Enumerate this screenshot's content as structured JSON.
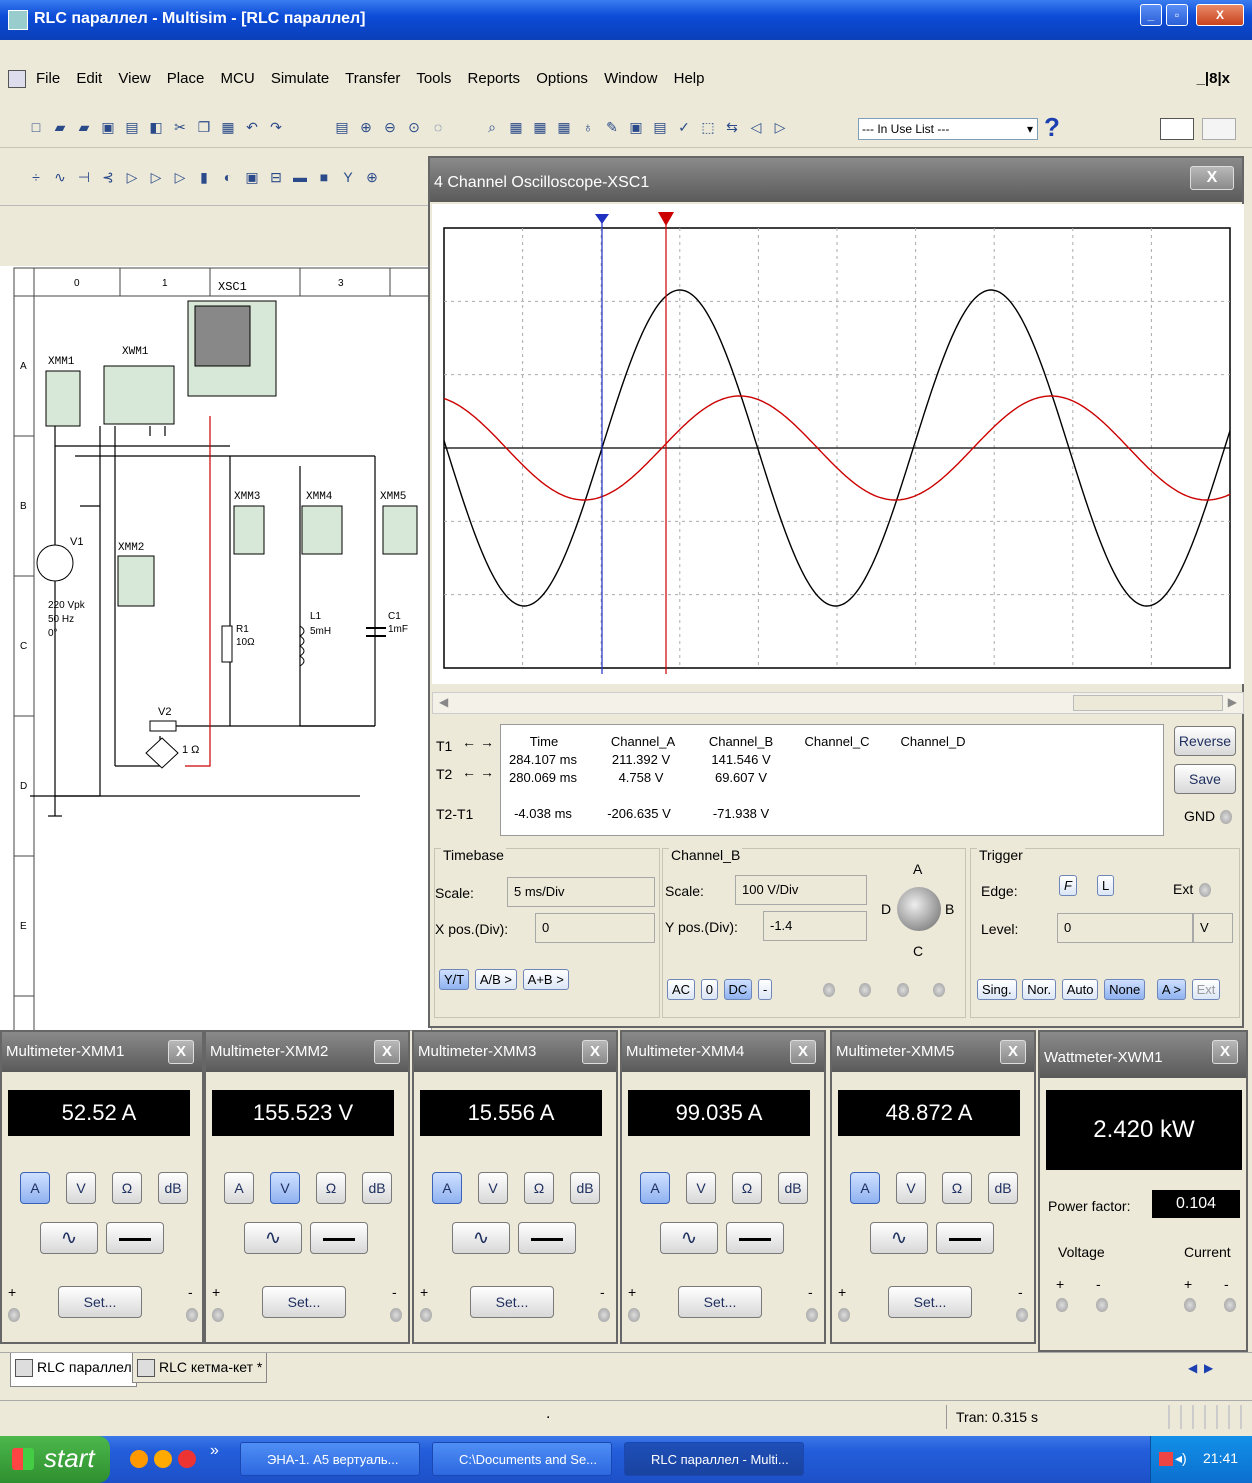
{
  "window": {
    "title": "RLC параллел - Multisim - [RLC параллел]",
    "min": "_",
    "max": "▫",
    "close": "X"
  },
  "menu": [
    "File",
    "Edit",
    "View",
    "Place",
    "MCU",
    "Simulate",
    "Transfer",
    "Tools",
    "Reports",
    "Options",
    "Window",
    "Help"
  ],
  "mdi_controls": "_|8|x",
  "toolbar": {
    "in_use_list": "--- In Use List ---",
    "help": "?"
  },
  "schematic": {
    "ruler": [
      "0",
      "1",
      "XSC1",
      "3"
    ],
    "rows": [
      "A",
      "B",
      "C",
      "D",
      "E"
    ],
    "labels": {
      "xmm1": "XMM1",
      "xwm1": "XWM1",
      "xsc1": "XSC1",
      "xmm2": "XMM2",
      "xmm3": "XMM3",
      "xmm4": "XMM4",
      "xmm5": "XMM5",
      "v1": "V1",
      "v1_params": [
        "220 Vpk",
        "50 Hz",
        "0°"
      ],
      "r1": "R1",
      "r1v": "10Ω",
      "l1": "L1",
      "l1v": "5mH",
      "c1": "C1",
      "c1v": "1mF",
      "v2": "V2",
      "v2v": "1 Ω"
    }
  },
  "osc": {
    "title": "4 Channel Oscilloscope-XSC1",
    "close": "X",
    "readout": {
      "headers": [
        "Time",
        "Channel_A",
        "Channel_B",
        "Channel_C",
        "Channel_D"
      ],
      "rows": [
        {
          "label": "T1",
          "time": "284.107 ms",
          "a": "211.392 V",
          "b": "141.546 V"
        },
        {
          "label": "T2",
          "time": "280.069 ms",
          "a": "4.758 V",
          "b": "69.607 V"
        },
        {
          "label": "T2-T1",
          "time": "-4.038 ms",
          "a": "-206.635 V",
          "b": "-71.938 V"
        }
      ],
      "reverse": "Reverse",
      "save": "Save",
      "gnd": "GND"
    },
    "timebase": {
      "title": "Timebase",
      "scale_label": "Scale:",
      "scale": "5 ms/Div",
      "xpos_label": "X pos.(Div):",
      "xpos": "0",
      "modes": [
        "Y/T",
        "A/B >",
        "A+B >"
      ]
    },
    "channel": {
      "title": "Channel_B",
      "scale_label": "Scale:",
      "scale": "100 V/Div",
      "ypos_label": "Y pos.(Div):",
      "ypos": "-1.4",
      "coupling": [
        "AC",
        "0",
        "DC",
        "-"
      ],
      "knob": [
        "A",
        "B",
        "C",
        "D"
      ]
    },
    "trigger": {
      "title": "Trigger",
      "edge_label": "Edge:",
      "edge_rise": "F",
      "edge_fall": "L",
      "ext": "Ext",
      "level_label": "Level:",
      "level": "0",
      "level_unit": "V",
      "modes": [
        "Sing.",
        "Nor.",
        "Auto",
        "None"
      ],
      "src": [
        "A >",
        "Ext"
      ]
    }
  },
  "meters": [
    {
      "title": "Multimeter-XMM1",
      "value": "52.52 A",
      "mode": "A"
    },
    {
      "title": "Multimeter-XMM2",
      "value": "155.523 V",
      "mode": "V"
    },
    {
      "title": "Multimeter-XMM3",
      "value": "15.556 A",
      "mode": "A"
    },
    {
      "title": "Multimeter-XMM4",
      "value": "99.035 A",
      "mode": "A"
    },
    {
      "title": "Multimeter-XMM5",
      "value": "48.872 A",
      "mode": "A"
    }
  ],
  "meter_buttons": [
    "A",
    "V",
    "Ω",
    "dB"
  ],
  "meter_set": "Set...",
  "meter_close": "X",
  "plus": "+",
  "minus": "-",
  "watt": {
    "title": "Wattmeter-XWM1",
    "value": "2.420 kW",
    "pf_label": "Power factor:",
    "pf": "0.104",
    "voltage": "Voltage",
    "current": "Current"
  },
  "tabs": [
    "RLC параллел",
    "RLC кетма-кет *"
  ],
  "status": {
    "dot": ".",
    "tran": "Tran: 0.315 s"
  },
  "taskbar": {
    "start": "start",
    "tasks": [
      "ЭНА-1. А5 вертуаль...",
      "C:\\Documents and Se...",
      "RLC параллел - Multi..."
    ],
    "clock": "21:41",
    "chevron": "»"
  }
}
